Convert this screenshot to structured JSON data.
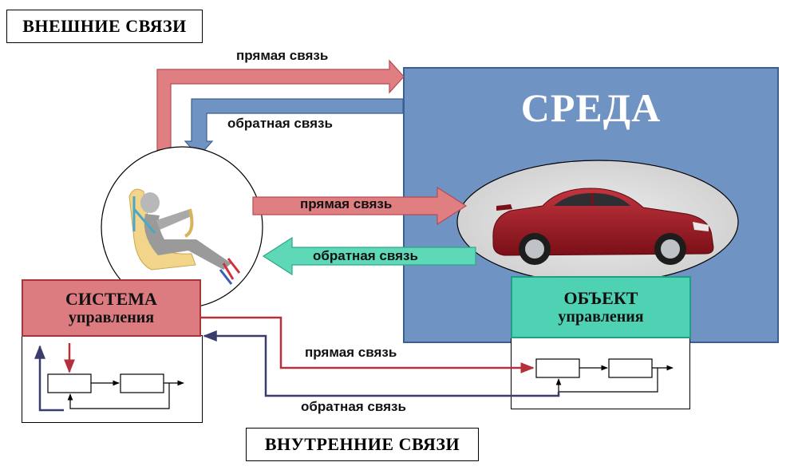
{
  "labels": {
    "external_links": "ВНЕШНИЕ СВЯЗИ",
    "internal_links": "ВНУТРЕННИЕ СВЯЗИ",
    "environment": "СРЕДА",
    "system_title": "СИСТЕМА",
    "system_subtitle": "управления",
    "object_title": "ОБЪЕКТ",
    "object_subtitle": "управления"
  },
  "arrows": {
    "top_forward": "прямая связь",
    "top_feedback": "обратная связь",
    "mid_forward": "прямая связь",
    "mid_feedback": "обратная связь",
    "bottom_forward": "прямая связь",
    "bottom_feedback": "обратная связь"
  },
  "colors": {
    "environment": "#6f93c2",
    "system": "#dd7c80",
    "object": "#4fd1b3",
    "forward_arrow": "#e07f82",
    "feedback_arrow_blue": "#6f93c2",
    "feedback_arrow_green": "#5fd8b8",
    "forward_line": "#b4303a",
    "feedback_line": "#3a3d6b"
  },
  "icons": {
    "driver": "driver-seated-illustration",
    "car": "red-sedan-car-illustration"
  }
}
